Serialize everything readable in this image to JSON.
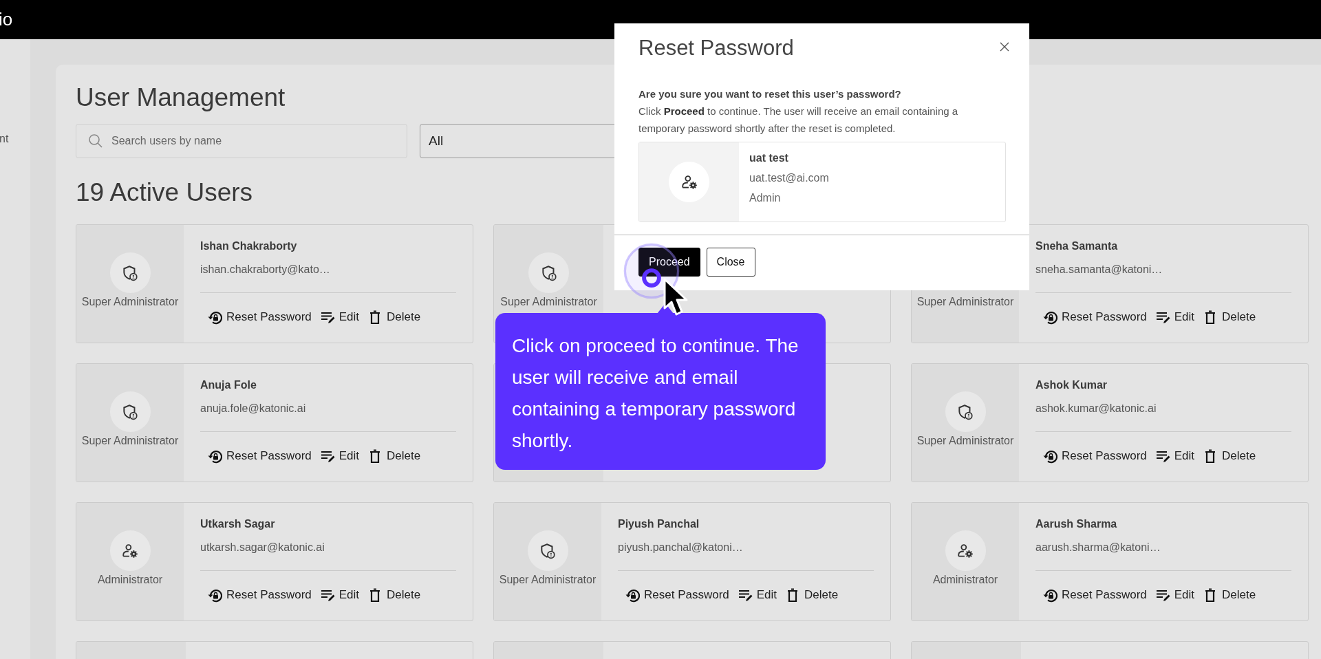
{
  "app_bar": {
    "title": "io"
  },
  "sidebar": {
    "items": [
      {
        "label": "nt"
      }
    ]
  },
  "page": {
    "title": "User Management",
    "search": {
      "placeholder": "Search users by name"
    },
    "role_filter": {
      "value": "All"
    },
    "heading": "19 Active Users"
  },
  "users": [
    {
      "name": "Ishan Chakraborty",
      "email": "ishan.chakraborty@kato…",
      "role": "Super Administrator",
      "kind": "shield",
      "actions": [
        {
          "kind": "reset",
          "label": "Reset Password"
        },
        {
          "kind": "edit",
          "label": "Edit"
        },
        {
          "kind": "delete",
          "label": "Delete"
        }
      ]
    },
    {
      "role": "Super Administrator",
      "kind": "shield"
    },
    {
      "name": "Sneha Samanta",
      "email": "sneha.samanta@katoni…",
      "role": "Super Administrator",
      "kind": "blank",
      "actions": [
        {
          "kind": "reset",
          "label": "Reset Password"
        },
        {
          "kind": "edit",
          "label": "Edit"
        },
        {
          "kind": "delete",
          "label": "Delete"
        }
      ]
    },
    {
      "name": "Anuja Fole",
      "email": "anuja.fole@katonic.ai",
      "role": "Super Administrator",
      "kind": "shield",
      "actions": [
        {
          "kind": "reset",
          "label": "Reset Password"
        },
        {
          "kind": "edit",
          "label": "Edit"
        },
        {
          "kind": "delete",
          "label": "Delete"
        }
      ]
    },
    {
      "kind": "blank"
    },
    {
      "name": "Ashok Kumar",
      "email": "ashok.kumar@katonic.ai",
      "role": "Super Administrator",
      "kind": "shield",
      "actions": [
        {
          "kind": "reset",
          "label": "Reset Password"
        },
        {
          "kind": "edit",
          "label": "Edit"
        },
        {
          "kind": "delete",
          "label": "Delete"
        }
      ]
    },
    {
      "name": "Utkarsh Sagar",
      "email": "utkarsh.sagar@katonic.ai",
      "role": "Administrator",
      "kind": "gear",
      "actions": [
        {
          "kind": "reset",
          "label": "Reset Password"
        },
        {
          "kind": "edit",
          "label": "Edit"
        },
        {
          "kind": "delete",
          "label": "Delete"
        }
      ]
    },
    {
      "name": "Piyush Panchal",
      "email": "piyush.panchal@katoni…",
      "role": "Super Administrator",
      "kind": "shield",
      "actions": [
        {
          "kind": "reset",
          "label": "Reset Password"
        },
        {
          "kind": "edit",
          "label": "Edit"
        },
        {
          "kind": "delete",
          "label": "Delete"
        }
      ]
    },
    {
      "name": "Aarush Sharma",
      "email": "aarush.sharma@katoni…",
      "role": "Administrator",
      "kind": "gear",
      "actions": [
        {
          "kind": "reset",
          "label": "Reset Password"
        },
        {
          "kind": "edit",
          "label": "Edit"
        },
        {
          "kind": "delete",
          "label": "Delete"
        }
      ]
    },
    {
      "kind": "blank"
    },
    {
      "kind": "blank"
    },
    {
      "kind": "blank"
    }
  ],
  "dialog": {
    "title": "Reset Password",
    "question": "Are you sure you want to reset this user’s password?",
    "message": "Click **Proceed** to continue. The user will receive an email containing a temporary password shortly after the reset is completed.",
    "user": {
      "name": "uat test",
      "email": "uat.test@ai.com",
      "role": "Admin",
      "kind": "gear"
    },
    "buttons": [
      {
        "kind": "primary",
        "label": "Proceed"
      },
      {
        "kind": "secondary",
        "label": "Close"
      }
    ]
  },
  "tooltip": {
    "text": "Click on proceed to continue. The user will receive and email containing a temporary password shortly."
  }
}
